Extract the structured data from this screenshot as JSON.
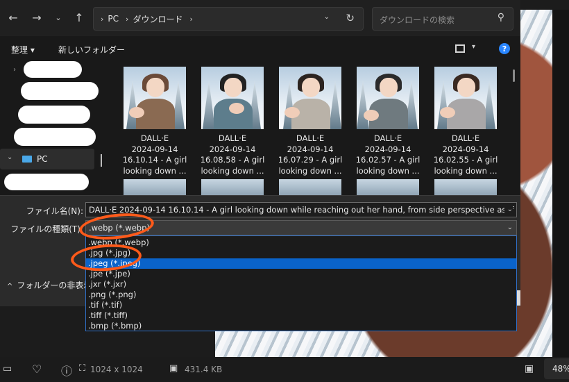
{
  "address": {
    "segments": [
      "PC",
      "ダウンロード"
    ],
    "search_placeholder": "ダウンロードの検索"
  },
  "commands": {
    "organize": "整理",
    "new_folder": "新しいフォルダー"
  },
  "nav": {
    "pc_label": "PC"
  },
  "thumbnails": [
    {
      "line1": "DALL·E",
      "line2": "2024-09-14",
      "line3": "16.10.14 - A girl",
      "line4": "looking down ..."
    },
    {
      "line1": "DALL·E",
      "line2": "2024-09-14",
      "line3": "16.08.58 - A girl",
      "line4": "looking down ..."
    },
    {
      "line1": "DALL·E",
      "line2": "2024-09-14",
      "line3": "16.07.29 - A girl",
      "line4": "looking down ..."
    },
    {
      "line1": "DALL·E",
      "line2": "2024-09-14",
      "line3": "16.02.57 - A girl",
      "line4": "looking down ..."
    },
    {
      "line1": "DALL·E",
      "line2": "2024-09-14",
      "line3": "16.02.55 - A girl",
      "line4": "looking down ..."
    }
  ],
  "save": {
    "filename_label": "ファイル名(N):",
    "filename_value": "DALL·E 2024-09-14 16.10.14 - A girl looking down while reaching out her hand, from side perspective as if the view",
    "type_label": "ファイルの種類(T):",
    "type_value": ".webp (*.webp)",
    "folder_toggle": "フォルダーの非表示",
    "options": [
      ".webp (*.webp)",
      ".jpg (*.jpg)",
      ".jpeg (*.jpeg)",
      ".jpe (*.jpe)",
      ".jxr (*.jxr)",
      ".png (*.png)",
      ".tif (*.tif)",
      ".tiff (*.tiff)",
      ".bmp (*.bmp)"
    ],
    "selected_index": 2
  },
  "status": {
    "dimensions": "1024 x 1024",
    "size": "431.4 KB",
    "zoom": "48%"
  },
  "icons": {
    "back": "back-arrow-icon",
    "forward": "forward-arrow-icon",
    "up": "up-arrow-icon",
    "refresh": "refresh-icon",
    "search": "search-icon",
    "help": "help-icon"
  },
  "colors": {
    "accent": "#0a63c9",
    "annotation": "#ff5a1a",
    "help_blue": "#2a86ff"
  }
}
